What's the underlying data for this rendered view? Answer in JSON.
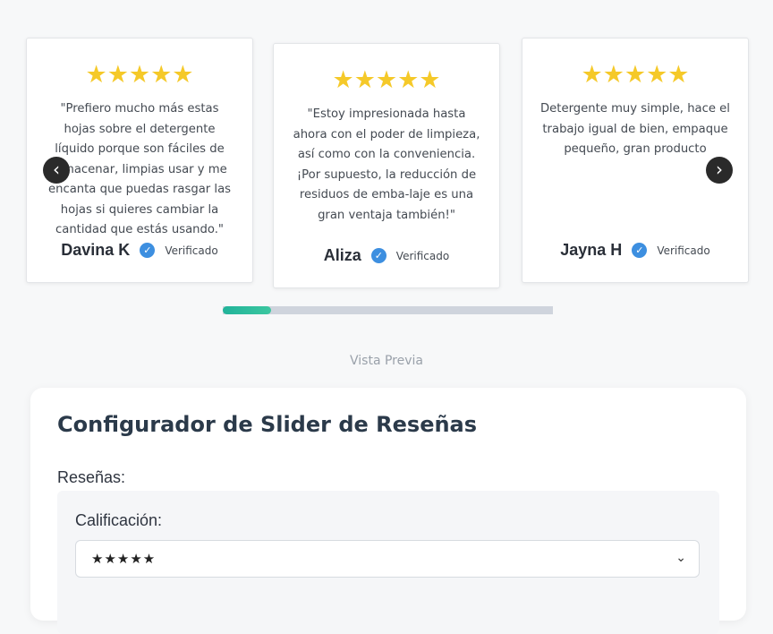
{
  "reviews": [
    {
      "stars": "★★★★★",
      "text": "\"Prefiero mucho más estas hojas sobre el detergente líquido porque son fáciles de almacenar, limpias usar y me encanta que puedas rasgar las hojas si quieres cambiar la cantidad que estás usando.\"",
      "author": "Davina K",
      "verified": "Verificado"
    },
    {
      "stars": "★★★★★",
      "text": "\"Estoy impresionada hasta ahora con el poder de limpieza, así como con la conveniencia. ¡Por supuesto, la reducción de residuos de emba-laje es una gran ventaja también!\"",
      "author": "Aliza",
      "verified": "Verificado"
    },
    {
      "stars": "★★★★★",
      "text": "Detergente muy simple, hace el trabajo igual de bien, empaque pequeño, gran producto",
      "author": "Jayna H",
      "verified": "Verificado"
    }
  ],
  "slider": {
    "prev_icon": "‹",
    "next_icon": "›",
    "progress": 0.145,
    "progress_color": "#21b39a"
  },
  "preview_label": "Vista Previa",
  "config": {
    "title": "Configurador de Slider de Reseñas",
    "reviews_label": "Reseñas:",
    "rating_label": "Calificación:",
    "rating_value": "★★★★★",
    "chevron_icon": "⌄"
  },
  "colors": {
    "star": "#f5c929",
    "badge": "#3d8fe0"
  }
}
